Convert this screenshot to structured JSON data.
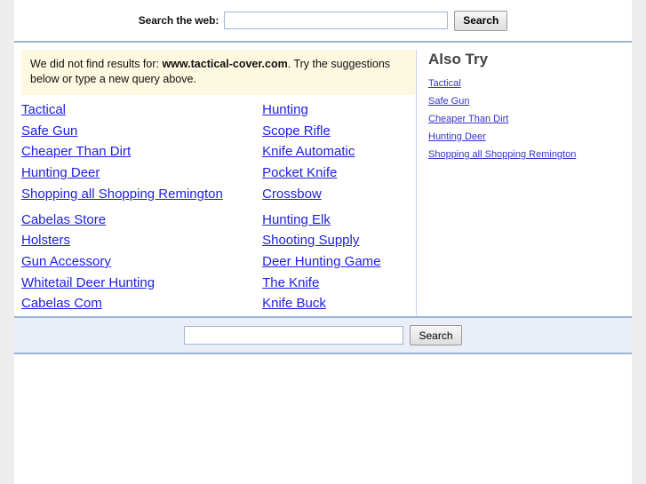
{
  "header": {
    "search_label": "Search the web:",
    "search_value": "",
    "search_placeholder": "",
    "search_button": "Search"
  },
  "notice": {
    "prefix": "We did not find results for: ",
    "query": "www.tactical-cover.com",
    "suffix": ". Try the suggestions below or type a new query above."
  },
  "suggestions": {
    "col1_group1": [
      "Tactical",
      "Safe Gun",
      "Cheaper Than Dirt",
      "Hunting Deer",
      "Shopping all Shopping Remington"
    ],
    "col1_group2": [
      "Cabelas Store",
      "Holsters",
      "Gun Accessory",
      "Whitetail Deer Hunting",
      "Cabelas Com"
    ],
    "col2_group1": [
      "Hunting",
      "Scope Rifle",
      "Knife Automatic",
      "Pocket Knife",
      "Crossbow"
    ],
    "col2_group2": [
      "Hunting Elk",
      "Shooting Supply",
      "Deer Hunting Game",
      "The Knife",
      "Knife Buck"
    ]
  },
  "sidebar": {
    "title": "Also Try",
    "links": [
      "Tactical",
      "Safe Gun",
      "Cheaper Than Dirt",
      "Hunting Deer",
      "Shopping all Shopping Remington"
    ]
  },
  "footer": {
    "search_value": "",
    "search_placeholder": "",
    "search_button": "Search"
  },
  "colors": {
    "link": "#2020e0",
    "sidebar_link": "#3333cc",
    "notice_bg": "#fdf9e1",
    "band_bg": "#eaeef7",
    "rule": "#9fb4d4",
    "page_bg": "#ededed"
  }
}
